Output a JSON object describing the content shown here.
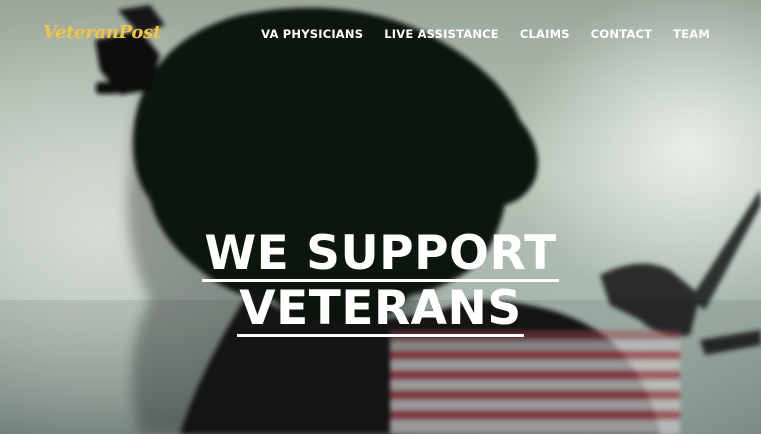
{
  "brand": {
    "logo_text": "VeteranPost",
    "logo_color": "#f4c542"
  },
  "nav": {
    "items": [
      {
        "label": "VA PHYSICIANS"
      },
      {
        "label": "LIVE ASSISTANCE"
      },
      {
        "label": "CLAIMS"
      },
      {
        "label": "CONTACT"
      },
      {
        "label": "TEAM"
      }
    ]
  },
  "hero": {
    "headline_line1": "WE SUPPORT",
    "headline_line2": "VETERANS",
    "background_image": "soldier-silhouette-with-american-flag"
  }
}
